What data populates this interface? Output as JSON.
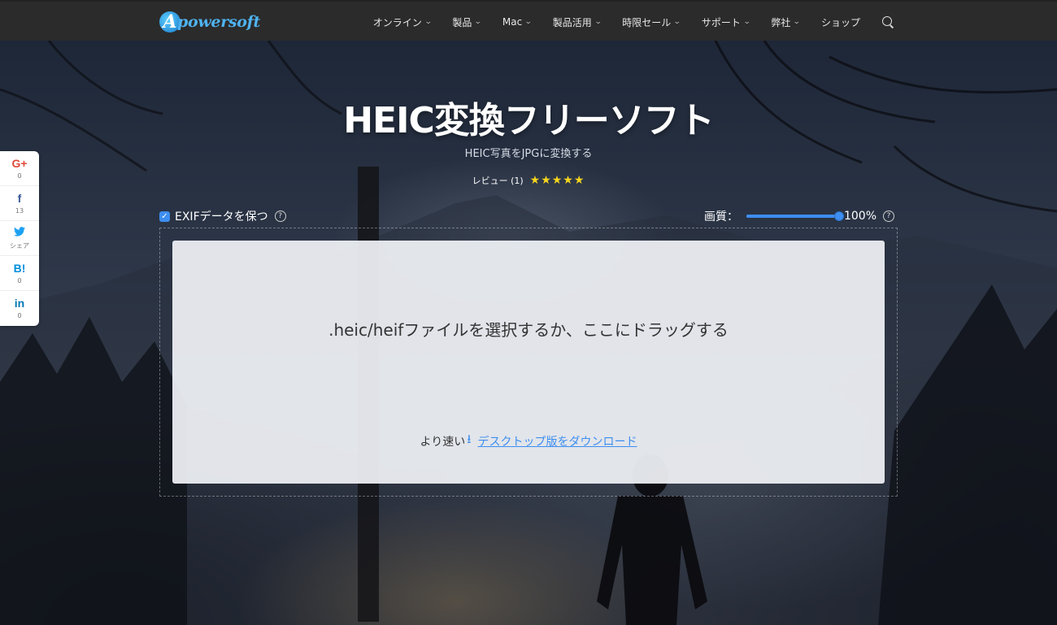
{
  "header": {
    "logo_letter": "A",
    "logo_text": "powersoft",
    "nav": [
      {
        "label": "オンライン",
        "chevron": true
      },
      {
        "label": "製品",
        "chevron": true
      },
      {
        "label": "Mac",
        "chevron": true
      },
      {
        "label": "製品活用",
        "chevron": true
      },
      {
        "label": "時限セール",
        "chevron": true
      },
      {
        "label": "サポート",
        "chevron": true
      },
      {
        "label": "弊社",
        "chevron": true
      },
      {
        "label": "ショップ",
        "chevron": false
      }
    ],
    "search_icon": "search-icon"
  },
  "social": [
    {
      "icon": "G+",
      "count": "0",
      "color": "#dd4b39",
      "name": "googleplus"
    },
    {
      "icon": "f",
      "count": "13",
      "color": "#3b5998",
      "name": "facebook"
    },
    {
      "icon": "🐦",
      "count": "シェア",
      "color": "#1da1f2",
      "name": "twitter"
    },
    {
      "icon": "B!",
      "count": "0",
      "color": "#008fde",
      "name": "hatena"
    },
    {
      "icon": "in",
      "count": "0",
      "color": "#0077b5",
      "name": "linkedin"
    }
  ],
  "hero": {
    "title": "HEIC変換フリーソフト",
    "subtitle": "HEIC写真をJPGに変換する",
    "review_label": "レビュー (1)",
    "stars": "★★★★★",
    "rating": 5
  },
  "options": {
    "exif_label": "EXIFデータを保つ",
    "exif_checked": true,
    "help_glyph": "?",
    "quality_label": "画質：",
    "quality_value": "100%",
    "quality_level": 1.0
  },
  "dropzone": {
    "prompt": ".heic/heifファイルを選択するか、ここにドラッグする",
    "faster_label": "より速い",
    "download_link": "デスクトップ版をダウンロード"
  },
  "colors": {
    "accent": "#3d8ef0",
    "star": "#f7d51d",
    "topbar": "#2b2b2b"
  }
}
